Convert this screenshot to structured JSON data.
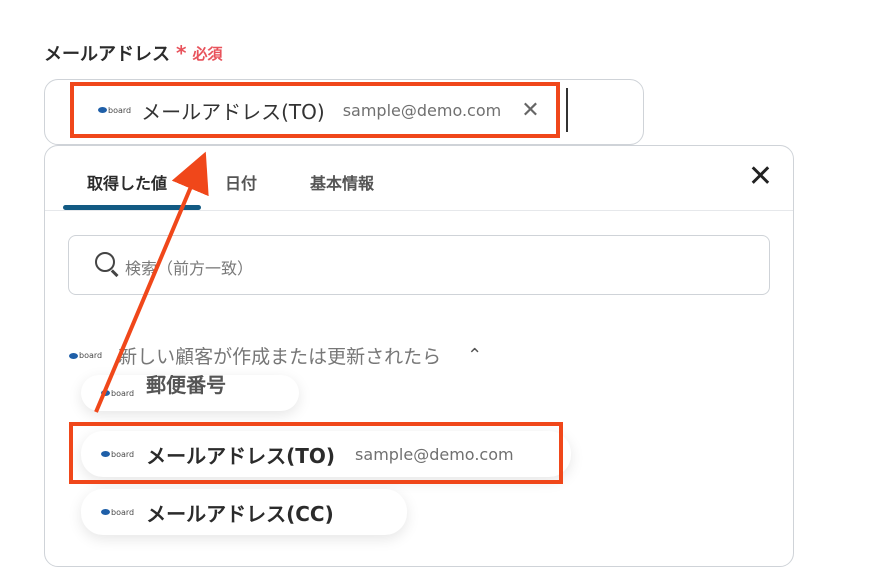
{
  "field": {
    "label": "メールアドレス",
    "required_star": "*",
    "required_text": "必須",
    "chip": {
      "label": "メールアドレス(TO)",
      "value": "sample@demo.com",
      "app_logo_text": "board"
    }
  },
  "panel": {
    "tabs": [
      {
        "label": "取得した値",
        "active": true
      },
      {
        "label": "日付",
        "active": false
      },
      {
        "label": "基本情報",
        "active": false
      }
    ],
    "search_placeholder": "検索（前方一致）",
    "group": {
      "app_logo_text": "board",
      "title": "新しい顧客が作成または更新されたら"
    },
    "items": [
      {
        "label": "郵便番号",
        "value": ""
      },
      {
        "label": "メールアドレス(TO)",
        "value": "sample@demo.com"
      },
      {
        "label": "メールアドレス(CC)",
        "value": ""
      }
    ]
  },
  "annotation": {
    "highlight_color": "#f0471a"
  },
  "colors": {
    "accent_tab": "#125a83",
    "required": "#e8525b"
  },
  "icons": [
    "close-icon",
    "search-icon",
    "chevron-up-icon",
    "arrow-annotation"
  ]
}
